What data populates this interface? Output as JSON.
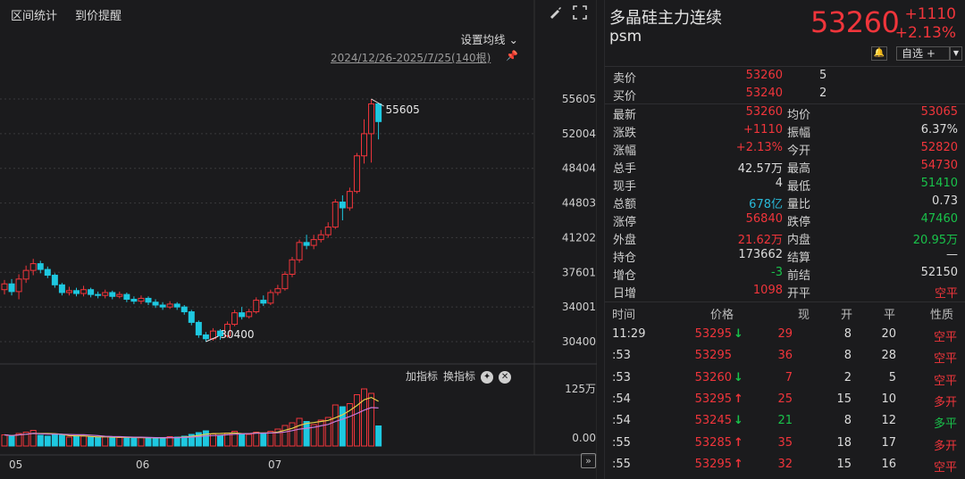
{
  "toolbar": {
    "interval_stats": "区间统计",
    "price_alert": "到价提醒",
    "ma_settings": "设置均线",
    "range": "2024/12/26-2025/7/25(140根)"
  },
  "chart": {
    "y_ticks": [
      "55605",
      "52004",
      "48404",
      "44803",
      "41202",
      "37601",
      "34001",
      "30400"
    ],
    "high_marker": "55605",
    "low_marker": "30400",
    "volume_ticks": [
      "125万",
      "0.00"
    ],
    "months": [
      "05",
      "06",
      "07"
    ],
    "add_indicator": "加指标",
    "switch_indicator": "换指标",
    "colors": {
      "up": "#f0353b",
      "down": "#1ec8e0",
      "ma1": "#e8d04a",
      "ma2": "#c878d8",
      "ma3": "#ffffff"
    }
  },
  "chart_data": {
    "type": "candlestick",
    "title": "",
    "y_range": [
      30400,
      55605
    ],
    "x_ticks": [
      "05",
      "06",
      "07"
    ],
    "candles": [
      {
        "o": 35800,
        "c": 36400,
        "h": 36800,
        "l": 35300
      },
      {
        "o": 36400,
        "c": 35600,
        "h": 36900,
        "l": 35200
      },
      {
        "o": 35600,
        "c": 36900,
        "h": 37400,
        "l": 34800
      },
      {
        "o": 36900,
        "c": 37800,
        "h": 38300,
        "l": 36500
      },
      {
        "o": 37800,
        "c": 38500,
        "h": 39000,
        "l": 37300
      },
      {
        "o": 38500,
        "c": 37900,
        "h": 38800,
        "l": 37500
      },
      {
        "o": 37900,
        "c": 37300,
        "h": 38200,
        "l": 37000
      },
      {
        "o": 37300,
        "c": 36300,
        "h": 37500,
        "l": 36000
      },
      {
        "o": 36300,
        "c": 35500,
        "h": 36500,
        "l": 35200
      },
      {
        "o": 35500,
        "c": 35700,
        "h": 36100,
        "l": 35200
      },
      {
        "o": 35700,
        "c": 35400,
        "h": 36000,
        "l": 35100
      },
      {
        "o": 35400,
        "c": 35800,
        "h": 36200,
        "l": 35100
      },
      {
        "o": 35800,
        "c": 35300,
        "h": 36000,
        "l": 35000
      },
      {
        "o": 35300,
        "c": 35200,
        "h": 35600,
        "l": 34900
      },
      {
        "o": 35200,
        "c": 35500,
        "h": 35800,
        "l": 34900
      },
      {
        "o": 35500,
        "c": 35100,
        "h": 35700,
        "l": 34800
      },
      {
        "o": 35100,
        "c": 35300,
        "h": 35600,
        "l": 34900
      },
      {
        "o": 35300,
        "c": 34800,
        "h": 35500,
        "l": 34500
      },
      {
        "o": 34800,
        "c": 34600,
        "h": 35100,
        "l": 34300
      },
      {
        "o": 34600,
        "c": 34900,
        "h": 35200,
        "l": 34300
      },
      {
        "o": 34900,
        "c": 34500,
        "h": 35100,
        "l": 34200
      },
      {
        "o": 34500,
        "c": 34200,
        "h": 34800,
        "l": 33900
      },
      {
        "o": 34200,
        "c": 34000,
        "h": 34500,
        "l": 33700
      },
      {
        "o": 34000,
        "c": 34300,
        "h": 34600,
        "l": 33800
      },
      {
        "o": 34300,
        "c": 34000,
        "h": 34500,
        "l": 33700
      },
      {
        "o": 34000,
        "c": 33500,
        "h": 34200,
        "l": 33200
      },
      {
        "o": 33500,
        "c": 32400,
        "h": 33700,
        "l": 32100
      },
      {
        "o": 32400,
        "c": 31100,
        "h": 32600,
        "l": 30800
      },
      {
        "o": 31100,
        "c": 30700,
        "h": 31400,
        "l": 30400
      },
      {
        "o": 30700,
        "c": 31500,
        "h": 31800,
        "l": 30500
      },
      {
        "o": 31500,
        "c": 31000,
        "h": 31700,
        "l": 30600
      },
      {
        "o": 31000,
        "c": 32200,
        "h": 32500,
        "l": 30800
      },
      {
        "o": 32200,
        "c": 33400,
        "h": 33700,
        "l": 32000
      },
      {
        "o": 33400,
        "c": 33000,
        "h": 34000,
        "l": 32700
      },
      {
        "o": 33000,
        "c": 33500,
        "h": 33800,
        "l": 32800
      },
      {
        "o": 33500,
        "c": 34700,
        "h": 35000,
        "l": 33300
      },
      {
        "o": 34700,
        "c": 34400,
        "h": 35200,
        "l": 34100
      },
      {
        "o": 34400,
        "c": 35500,
        "h": 35800,
        "l": 34200
      },
      {
        "o": 35500,
        "c": 35900,
        "h": 36300,
        "l": 35200
      },
      {
        "o": 35900,
        "c": 37400,
        "h": 37700,
        "l": 35700
      },
      {
        "o": 37400,
        "c": 38900,
        "h": 39200,
        "l": 37100
      },
      {
        "o": 38900,
        "c": 40700,
        "h": 41000,
        "l": 38600
      },
      {
        "o": 40700,
        "c": 40400,
        "h": 41500,
        "l": 40000
      },
      {
        "o": 40400,
        "c": 41000,
        "h": 41500,
        "l": 40000
      },
      {
        "o": 41000,
        "c": 41500,
        "h": 42000,
        "l": 40700
      },
      {
        "o": 41500,
        "c": 42300,
        "h": 42800,
        "l": 41200
      },
      {
        "o": 42300,
        "c": 44900,
        "h": 45200,
        "l": 42100
      },
      {
        "o": 44900,
        "c": 44300,
        "h": 45600,
        "l": 43000
      },
      {
        "o": 44300,
        "c": 46000,
        "h": 46400,
        "l": 44000
      },
      {
        "o": 46000,
        "c": 49700,
        "h": 50000,
        "l": 45800
      },
      {
        "o": 49700,
        "c": 52000,
        "h": 53500,
        "l": 48900
      },
      {
        "o": 52000,
        "c": 55100,
        "h": 55605,
        "l": 49000
      },
      {
        "o": 55100,
        "c": 53260,
        "h": 54730,
        "l": 51410
      }
    ],
    "volume": [
      25,
      22,
      28,
      31,
      35,
      24,
      22,
      26,
      24,
      20,
      21,
      22,
      20,
      19,
      21,
      18,
      19,
      20,
      18,
      19,
      17,
      18,
      19,
      21,
      20,
      22,
      26,
      30,
      34,
      27,
      23,
      29,
      33,
      27,
      26,
      31,
      29,
      33,
      38,
      46,
      52,
      62,
      55,
      48,
      58,
      64,
      92,
      88,
      95,
      115,
      128,
      118,
      45
    ]
  },
  "quote": {
    "name": "多晶硅主力连续",
    "code": "psm",
    "last": "53260",
    "change": "+1110",
    "change_pct": "+2.13%",
    "watchlist": "自选 +",
    "ask_label": "卖价",
    "ask": "53260",
    "ask_qty": "5",
    "bid_label": "买价",
    "bid": "53240",
    "bid_qty": "2",
    "rows": [
      {
        "l1": "最新",
        "v1": "53260",
        "c1": "red",
        "l2": "均价",
        "v2": "53065",
        "c2": "red"
      },
      {
        "l1": "涨跌",
        "v1": "+1110",
        "c1": "red",
        "l2": "振幅",
        "v2": "6.37%",
        "c2": "white"
      },
      {
        "l1": "涨幅",
        "v1": "+2.13%",
        "c1": "red",
        "l2": "今开",
        "v2": "52820",
        "c2": "red"
      },
      {
        "l1": "总手",
        "v1": "42.57万",
        "c1": "white",
        "l2": "最高",
        "v2": "54730",
        "c2": "red"
      },
      {
        "l1": "现手",
        "v1": "4",
        "c1": "white",
        "l2": "最低",
        "v2": "51410",
        "c2": "green"
      },
      {
        "l1": "总额",
        "v1": "678亿",
        "c1": "cyan",
        "l2": "量比",
        "v2": "0.73",
        "c2": "white"
      },
      {
        "l1": "涨停",
        "v1": "56840",
        "c1": "red",
        "l2": "跌停",
        "v2": "47460",
        "c2": "green"
      },
      {
        "l1": "外盘",
        "v1": "21.62万",
        "c1": "red",
        "l2": "内盘",
        "v2": "20.95万",
        "c2": "green"
      },
      {
        "l1": "持仓",
        "v1": "173662",
        "c1": "white",
        "l2": "结算",
        "v2": "—",
        "c2": "white"
      },
      {
        "l1": "增仓",
        "v1": "-3",
        "c1": "green",
        "l2": "前结",
        "v2": "52150",
        "c2": "white"
      },
      {
        "l1": "日增",
        "v1": "1098",
        "c1": "red",
        "l2": "开平",
        "v2": "空平",
        "c2": "red"
      }
    ]
  },
  "trades": {
    "headers": [
      "时间",
      "价格",
      "现",
      "开",
      "平",
      "性质"
    ],
    "rows": [
      {
        "time": "11:29",
        "price": "53295",
        "dir": "down",
        "vol": "29",
        "vc": "red",
        "open": "8",
        "close": "20",
        "nature": "空平",
        "nc": "red"
      },
      {
        "time": ":53",
        "price": "53295",
        "dir": "none",
        "vol": "36",
        "vc": "red",
        "open": "8",
        "close": "28",
        "nature": "空平",
        "nc": "red"
      },
      {
        "time": ":53",
        "price": "53260",
        "dir": "down",
        "vol": "7",
        "vc": "red",
        "open": "2",
        "close": "5",
        "nature": "空平",
        "nc": "red"
      },
      {
        "time": ":54",
        "price": "53295",
        "dir": "up",
        "vol": "25",
        "vc": "red",
        "open": "15",
        "close": "10",
        "nature": "多开",
        "nc": "red"
      },
      {
        "time": ":54",
        "price": "53245",
        "dir": "down",
        "vol": "21",
        "vc": "green",
        "open": "8",
        "close": "12",
        "nature": "多平",
        "nc": "green"
      },
      {
        "time": ":55",
        "price": "53285",
        "dir": "up",
        "vol": "35",
        "vc": "red",
        "open": "18",
        "close": "17",
        "nature": "多开",
        "nc": "red"
      },
      {
        "time": ":55",
        "price": "53295",
        "dir": "up",
        "vol": "32",
        "vc": "red",
        "open": "15",
        "close": "16",
        "nature": "空平",
        "nc": "red"
      }
    ]
  }
}
